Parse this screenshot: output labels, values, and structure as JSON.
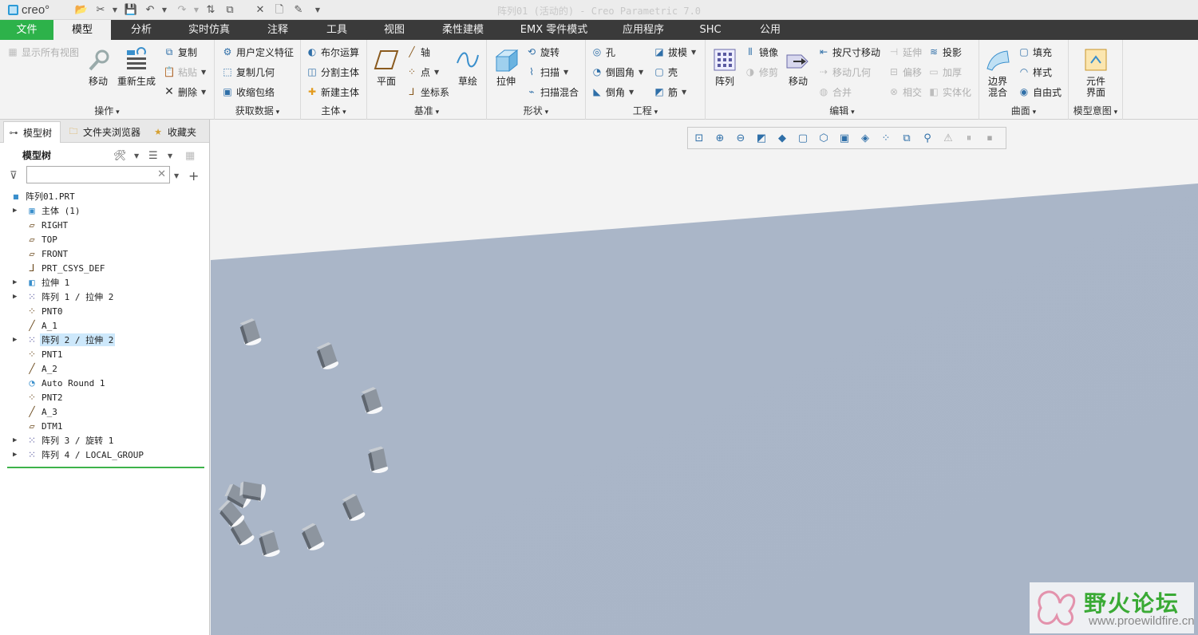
{
  "window": {
    "title": "阵列01 (活动的) - Creo Parametric 7.0",
    "logo": "creo°"
  },
  "ribbon_tabs": [
    "文件",
    "模型",
    "分析",
    "实时仿真",
    "注释",
    "工具",
    "视图",
    "柔性建模",
    "EMX 零件模式",
    "应用程序",
    "SHC",
    "公用"
  ],
  "groups": {
    "operations": {
      "label": "操作",
      "show_all_views": "显示所有视图",
      "move": "移动",
      "regenerate": "重新生成",
      "copy": "复制",
      "paste": "粘贴",
      "delete": "删除"
    },
    "get_data": {
      "label": "获取数据",
      "udf": "用户定义特征",
      "copy_geom": "复制几何",
      "shrinkwrap": "收缩包络"
    },
    "body": {
      "label": "主体",
      "boolean": "布尔运算",
      "split_body": "分割主体",
      "new_body": "新建主体"
    },
    "datum": {
      "label": "基准",
      "plane": "平面",
      "axis": "轴",
      "point": "点",
      "csys": "坐标系",
      "sketch": "草绘"
    },
    "shapes": {
      "label": "形状",
      "extrude": "拉伸",
      "revolve": "旋转",
      "sweep": "扫描",
      "swept_blend": "扫描混合"
    },
    "engineering": {
      "label": "工程",
      "hole": "孔",
      "round": "倒圆角",
      "chamfer": "倒角",
      "draft": "拔模",
      "shell": "壳",
      "rib": "筋"
    },
    "editing": {
      "label": "编辑",
      "pattern": "阵列",
      "mirror": "镜像",
      "trim": "修剪",
      "move": "移动",
      "move_by_dim": "按尺寸移动",
      "move_geom": "移动几何",
      "merge": "合并",
      "extend": "延伸",
      "offset": "偏移",
      "intersect": "相交",
      "project": "投影",
      "thicken": "加厚",
      "solidify": "实体化"
    },
    "surfaces": {
      "label": "曲面",
      "boundary_blend": "边界混合",
      "fill": "填充",
      "style": "样式",
      "freestyle": "自由式"
    },
    "model_intent": {
      "label": "模型意图",
      "component_interface": "元件界面"
    }
  },
  "left_tabs": [
    "模型树",
    "文件夹浏览器",
    "收藏夹"
  ],
  "model_tree": {
    "header": "模型树",
    "search_placeholder": "",
    "items": [
      {
        "label": "阵列01.PRT",
        "icon": "part-icon",
        "expandable": false,
        "selected": false
      },
      {
        "label": "主体 (1)",
        "icon": "body-icon",
        "expandable": true,
        "selected": false
      },
      {
        "label": "RIGHT",
        "icon": "datum-plane-icon",
        "expandable": false,
        "selected": false
      },
      {
        "label": "TOP",
        "icon": "datum-plane-icon",
        "expandable": false,
        "selected": false
      },
      {
        "label": "FRONT",
        "icon": "datum-plane-icon",
        "expandable": false,
        "selected": false
      },
      {
        "label": "PRT_CSYS_DEF",
        "icon": "csys-icon",
        "expandable": false,
        "selected": false
      },
      {
        "label": "拉伸 1",
        "icon": "extrude-icon",
        "expandable": true,
        "selected": false
      },
      {
        "label": "阵列 1 / 拉伸 2",
        "icon": "pattern-icon",
        "expandable": true,
        "selected": false
      },
      {
        "label": "PNT0",
        "icon": "point-icon",
        "expandable": false,
        "selected": false
      },
      {
        "label": "A_1",
        "icon": "axis-icon",
        "expandable": false,
        "selected": false
      },
      {
        "label": "阵列 2 / 拉伸 2",
        "icon": "pattern-icon",
        "expandable": true,
        "selected": true
      },
      {
        "label": "PNT1",
        "icon": "point-icon",
        "expandable": false,
        "selected": false
      },
      {
        "label": "A_2",
        "icon": "axis-icon",
        "expandable": false,
        "selected": false
      },
      {
        "label": "Auto Round 1",
        "icon": "auto-round-icon",
        "expandable": false,
        "selected": false
      },
      {
        "label": "PNT2",
        "icon": "point-icon",
        "expandable": false,
        "selected": false
      },
      {
        "label": "A_3",
        "icon": "axis-icon",
        "expandable": false,
        "selected": false
      },
      {
        "label": "DTM1",
        "icon": "datum-plane-icon",
        "expandable": false,
        "selected": false
      },
      {
        "label": "阵列 3 / 旋转 1",
        "icon": "pattern-icon",
        "expandable": true,
        "selected": false
      },
      {
        "label": "阵列 4 / LOCAL_GROUP",
        "icon": "pattern-icon",
        "expandable": true,
        "selected": false
      }
    ]
  },
  "watermark": {
    "title": "野火论坛",
    "url": "www.proewildfire.cn"
  },
  "colors": {
    "tab_bar": "#3a3a3a",
    "file_tab": "#2db24a",
    "plane": "#aab6c8",
    "selection": "#cde8fb"
  }
}
